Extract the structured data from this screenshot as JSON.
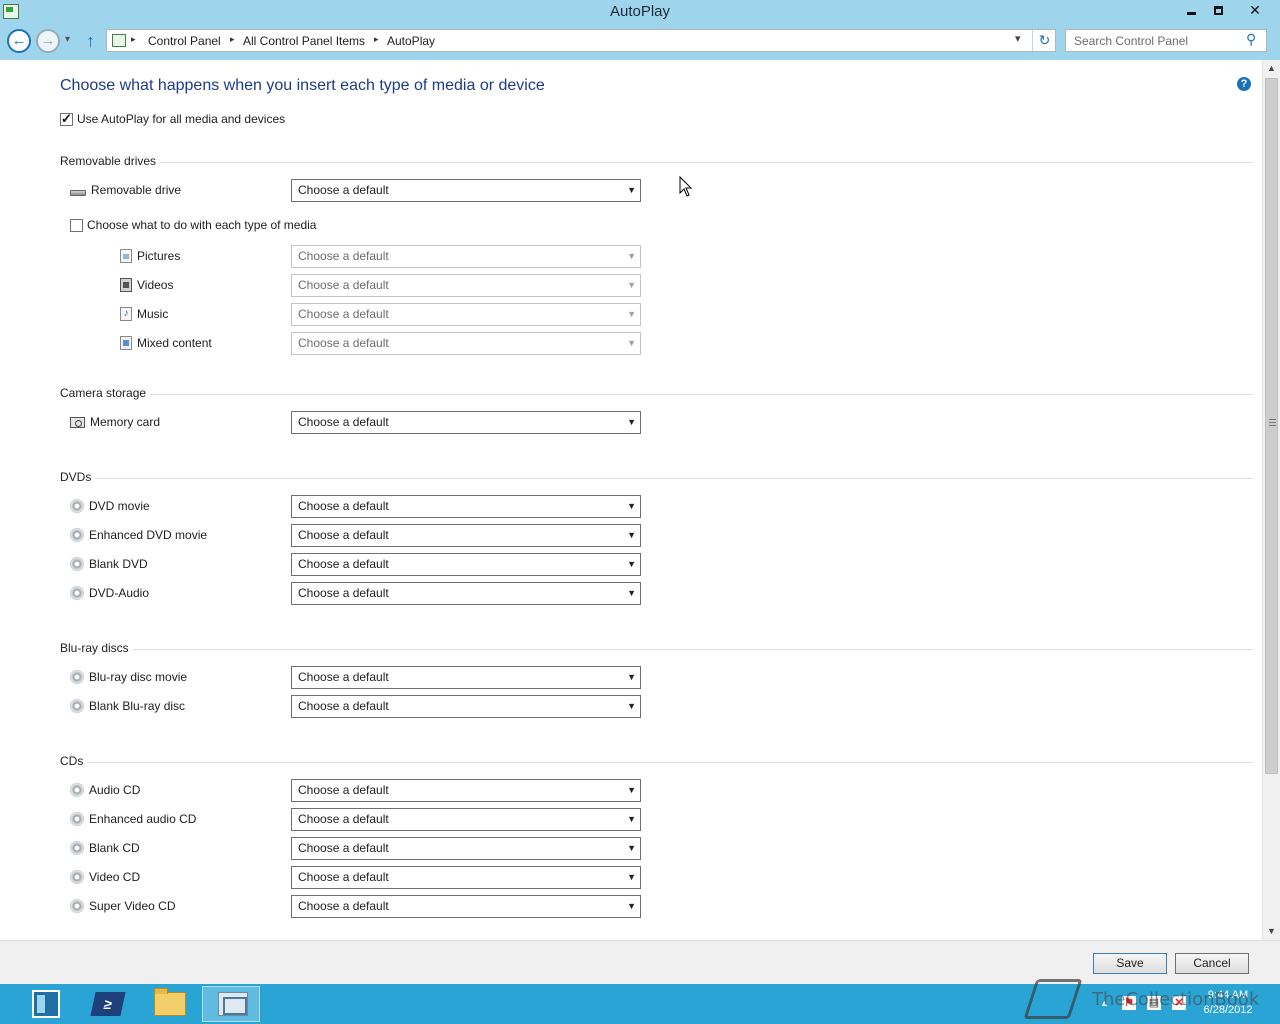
{
  "window": {
    "title": "AutoPlay",
    "minimize_glyph": "",
    "close_glyph": "✕"
  },
  "nav": {
    "back_glyph": "←",
    "forward_glyph": "→",
    "recent_glyph": "▾",
    "up_glyph": "↑",
    "breadcrumb": [
      "Control Panel",
      "All Control Panel Items",
      "AutoPlay"
    ],
    "crumb_separator": "▸",
    "dropdown_glyph": "▾",
    "refresh_glyph": "↻",
    "search_placeholder": "Search Control Panel",
    "search_glyph": "⚲"
  },
  "main": {
    "heading": "Choose what happens when you insert each type of media or device",
    "help_glyph": "?",
    "use_autoplay": {
      "label": "Use AutoPlay for all media and devices",
      "checked": true
    },
    "default_choice": "Choose a default",
    "select_arrow": "▼",
    "removable": {
      "section": "Removable drives",
      "drive_label": "Removable drive",
      "each_type": {
        "label": "Choose what to do with each type of media",
        "checked": false
      },
      "media": [
        {
          "label": "Pictures",
          "icon": "pictures-icon"
        },
        {
          "label": "Videos",
          "icon": "videos-icon"
        },
        {
          "label": "Music",
          "icon": "music-icon",
          "glyph": "♪"
        },
        {
          "label": "Mixed content",
          "icon": "mixed-content-icon"
        }
      ]
    },
    "camera": {
      "section": "Camera storage",
      "items": [
        {
          "label": "Memory card",
          "icon": "memory-card-icon"
        }
      ]
    },
    "dvds": {
      "section": "DVDs",
      "items": [
        {
          "label": "DVD movie",
          "icon": "dvd-movie-icon"
        },
        {
          "label": "Enhanced DVD movie",
          "icon": "enhanced-dvd-icon"
        },
        {
          "label": "Blank DVD",
          "icon": "blank-dvd-icon"
        },
        {
          "label": "DVD-Audio",
          "icon": "dvd-audio-icon"
        }
      ]
    },
    "bluray": {
      "section": "Blu-ray discs",
      "items": [
        {
          "label": "Blu-ray disc movie",
          "icon": "bluray-movie-icon"
        },
        {
          "label": "Blank Blu-ray disc",
          "icon": "blank-bluray-icon"
        }
      ]
    },
    "cds": {
      "section": "CDs",
      "items": [
        {
          "label": "Audio CD",
          "icon": "audio-cd-icon"
        },
        {
          "label": "Enhanced audio CD",
          "icon": "enhanced-audio-cd-icon"
        },
        {
          "label": "Blank CD",
          "icon": "blank-cd-icon"
        },
        {
          "label": "Video CD",
          "icon": "video-cd-icon"
        },
        {
          "label": "Super Video CD",
          "icon": "super-video-cd-icon"
        }
      ]
    }
  },
  "scrollbar": {
    "up_glyph": "▲",
    "down_glyph": "▼"
  },
  "footer": {
    "save": "Save",
    "cancel": "Cancel"
  },
  "taskbar": {
    "powershell_glyph": "≥",
    "tray_hidden_glyph": "▲",
    "tray_flag_glyph": "⚑",
    "tray_net_glyph": "▤",
    "tray_vol_glyph": "✕",
    "time": "9:44 AM",
    "date": "6/28/2012"
  },
  "watermark": {
    "text": "TheCollectionBook"
  },
  "colors": {
    "titlebar": "#9fd5ec",
    "heading": "#1e3b8a",
    "accent": "#1a73b8",
    "taskbar": "#2aa4d4"
  }
}
